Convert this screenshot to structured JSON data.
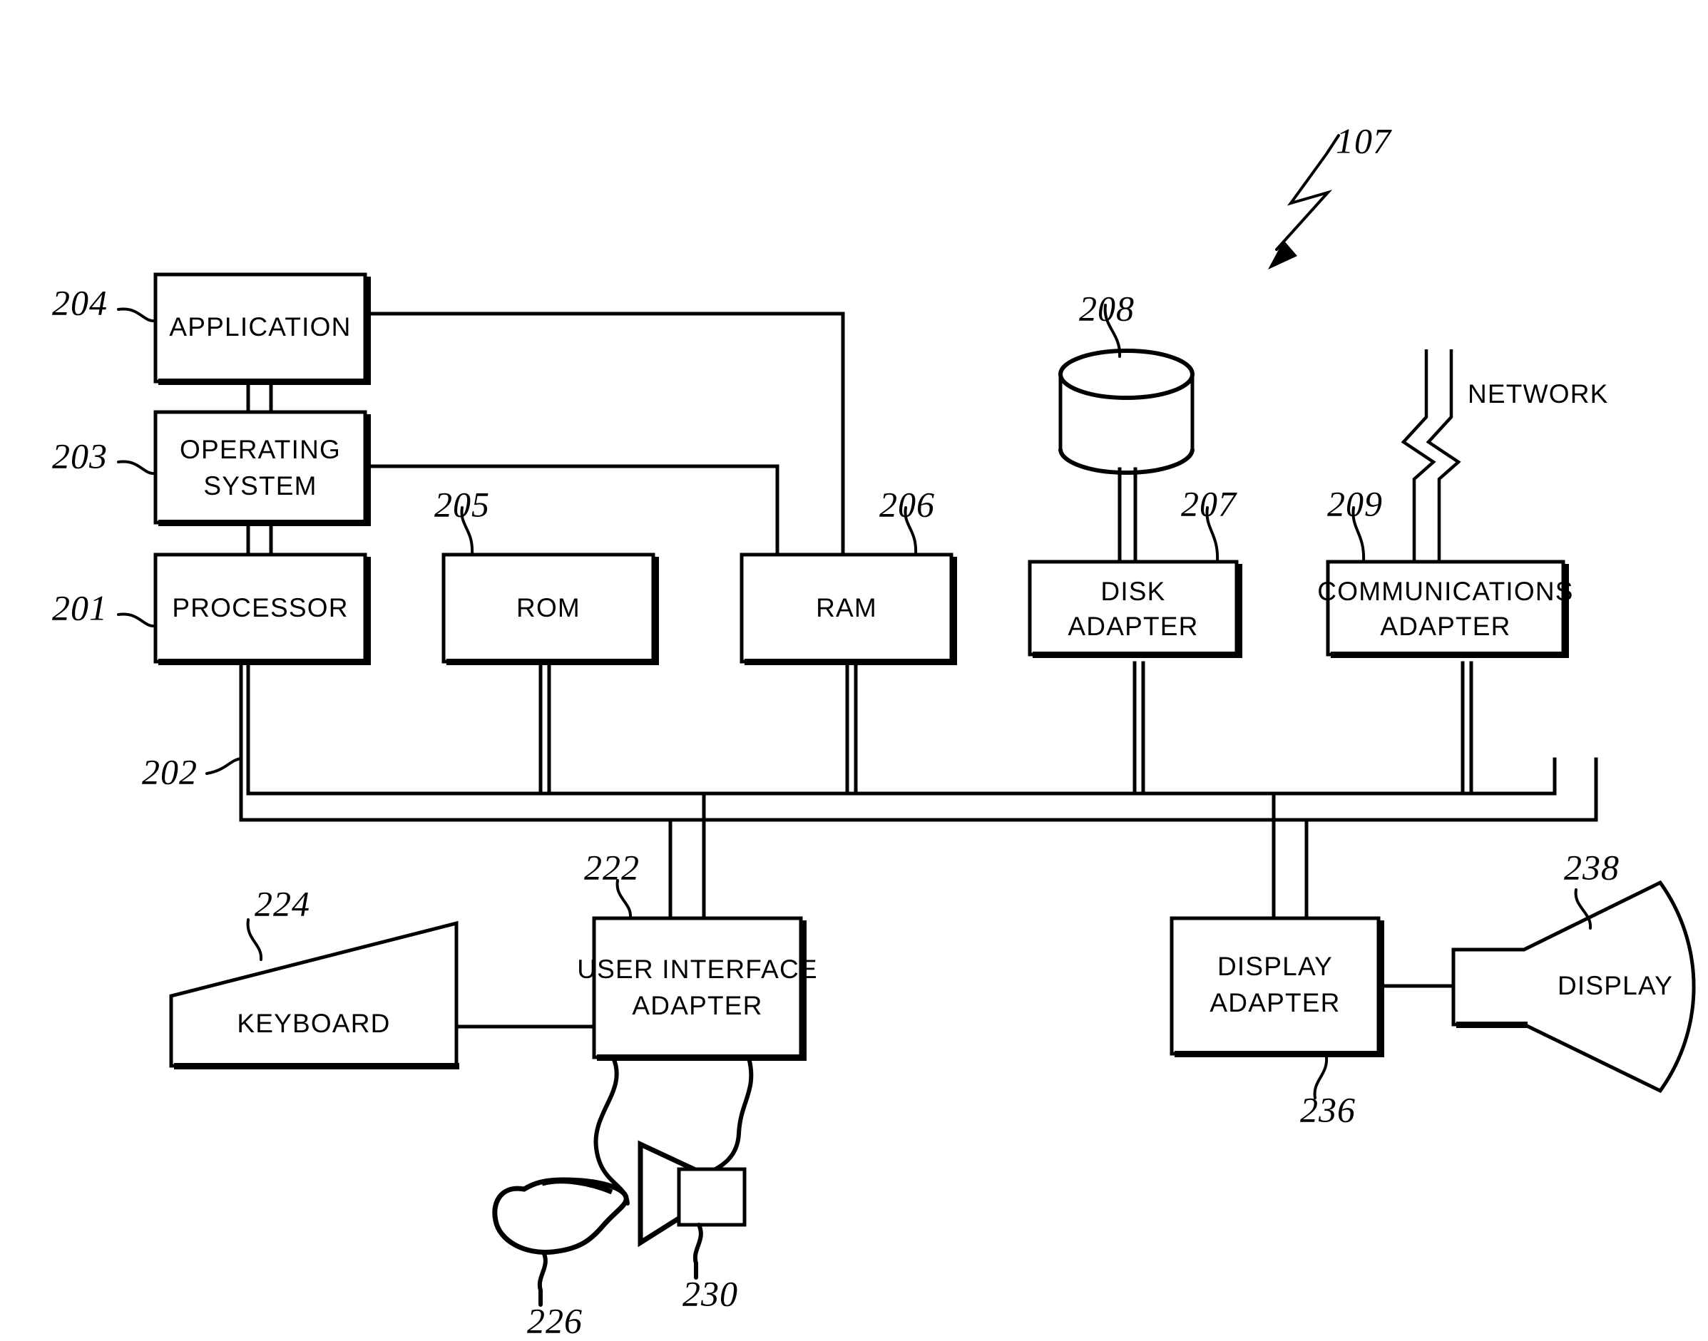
{
  "figure": {
    "type": "patent-block-diagram",
    "system_ref": "107",
    "network_label": "NETWORK"
  },
  "blocks": {
    "application": {
      "label": "APPLICATION",
      "ref": "204"
    },
    "operating": {
      "label_line1": "OPERATING",
      "label_line2": "SYSTEM",
      "ref": "203"
    },
    "processor": {
      "label": "PROCESSOR",
      "ref": "201"
    },
    "rom": {
      "label": "ROM",
      "ref": "205"
    },
    "ram": {
      "label": "RAM",
      "ref": "206"
    },
    "disk_adapter": {
      "label_line1": "DISK",
      "label_line2": "ADAPTER",
      "ref": "207"
    },
    "comm_adapter": {
      "label_line1": "COMMUNICATIONS",
      "label_line2": "ADAPTER",
      "ref": "209"
    },
    "ui_adapter": {
      "label_line1": "USER INTERFACE",
      "label_line2": "ADAPTER",
      "ref": "222"
    },
    "display_adapter": {
      "label_line1": "DISPLAY",
      "label_line2": "ADAPTER",
      "ref": "236"
    },
    "keyboard": {
      "label": "KEYBOARD",
      "ref": "224"
    },
    "display": {
      "label": "DISPLAY",
      "ref": "238"
    },
    "disk": {
      "label": "",
      "ref": "208"
    },
    "mouse": {
      "label": "",
      "ref": "226"
    },
    "speaker": {
      "label": "",
      "ref": "230"
    },
    "bus": {
      "label": "",
      "ref": "202"
    }
  },
  "colors": {
    "ink": "#000000",
    "paper": "#ffffff"
  }
}
